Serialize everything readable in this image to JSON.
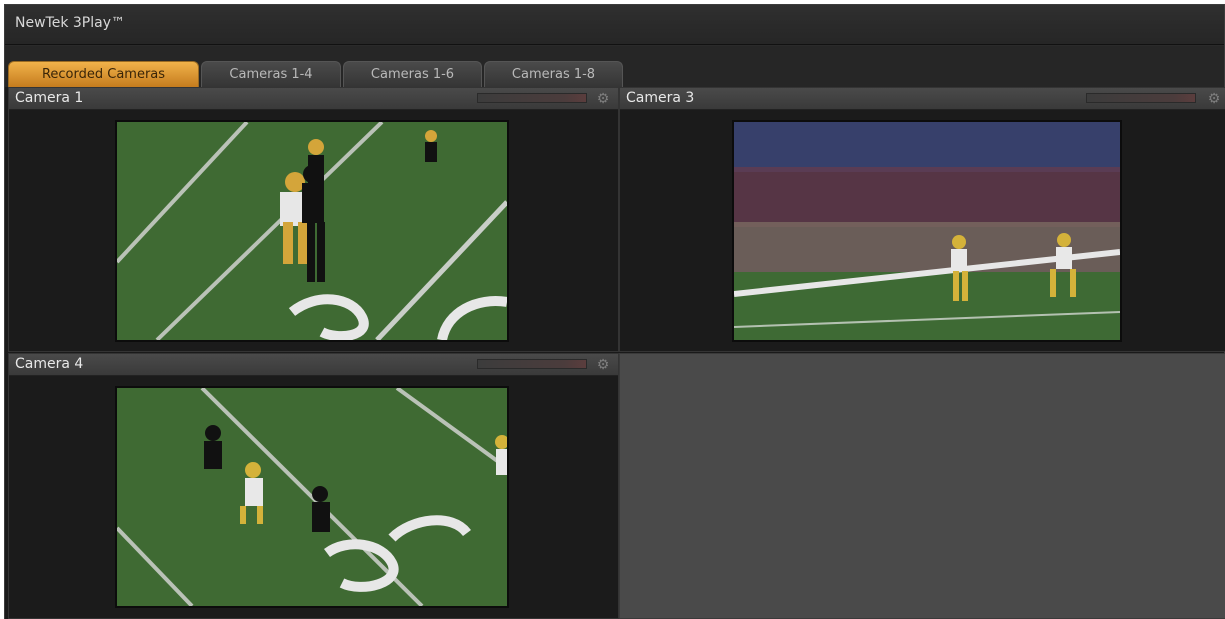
{
  "app": {
    "title": "NewTek 3Play™"
  },
  "tabs": [
    {
      "label": "Recorded Cameras",
      "active": true
    },
    {
      "label": "Cameras 1-4",
      "active": false
    },
    {
      "label": "Cameras 1-6",
      "active": false
    },
    {
      "label": "Cameras 1-8",
      "active": false
    }
  ],
  "panels": [
    {
      "title": "Camera 1",
      "icon": "gear-icon"
    },
    {
      "title": "Camera 3",
      "icon": "gear-icon"
    },
    {
      "title": "Camera 4",
      "icon": "gear-icon"
    }
  ],
  "colors": {
    "active_tab": "#e39a33",
    "field_green": "#3f6a33",
    "panel_bg": "#1b1b1b",
    "empty_panel": "#4a4a4a"
  }
}
